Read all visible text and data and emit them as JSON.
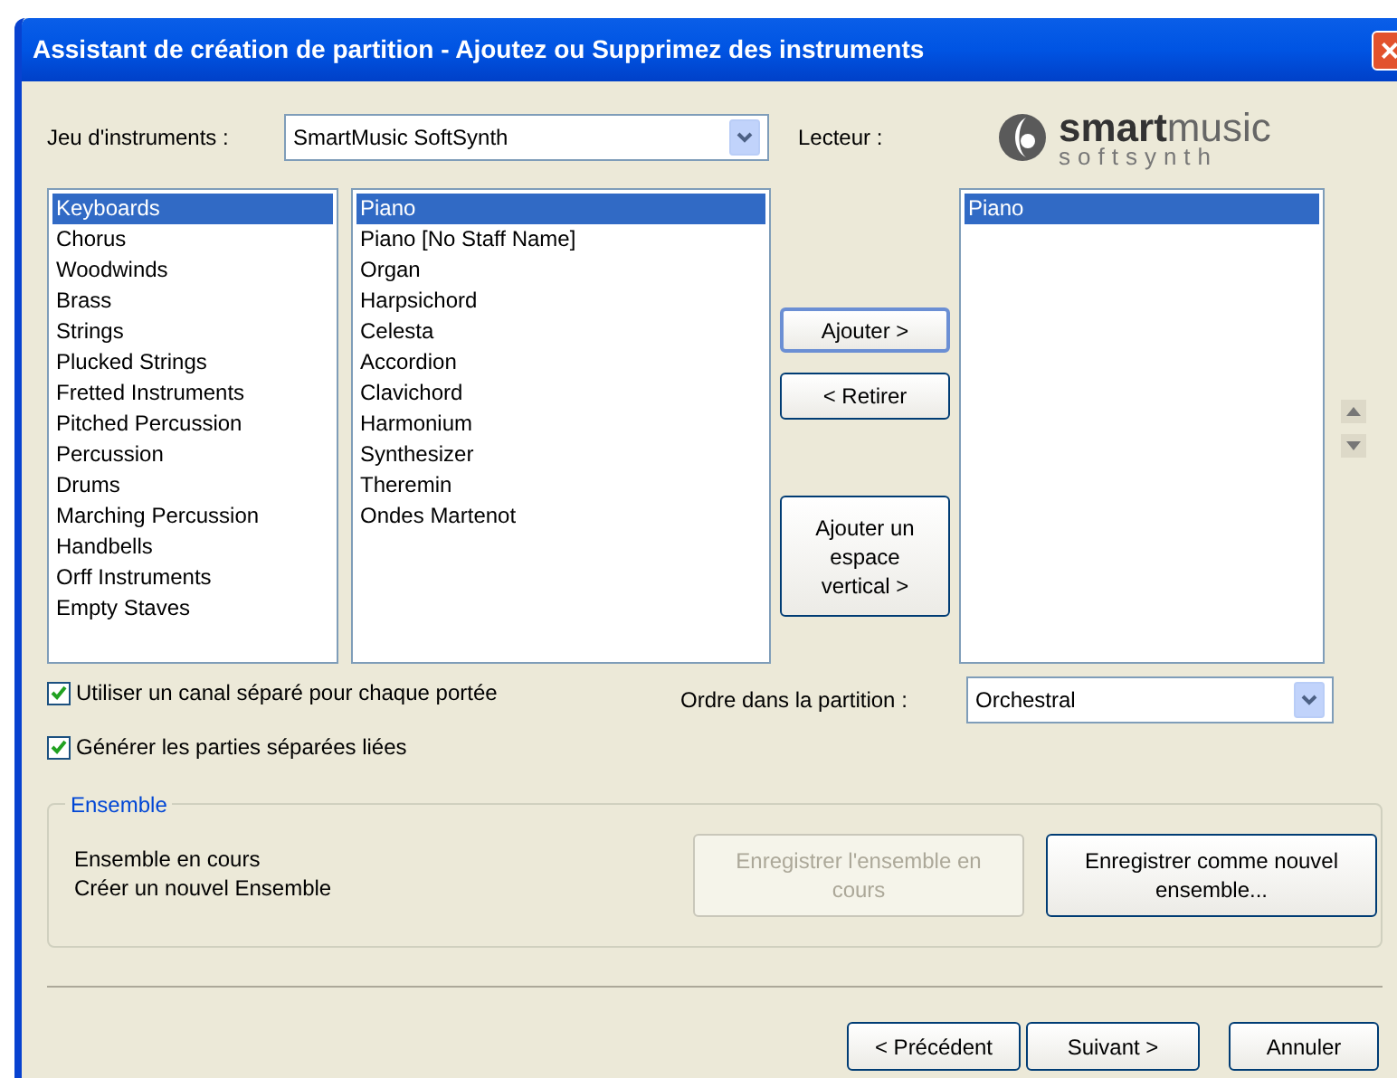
{
  "window": {
    "title": "Assistant de création de partition - Ajoutez ou Supprimez des instruments",
    "close": "×"
  },
  "instrument_set": {
    "label": "Jeu d'instruments :",
    "value": "SmartMusic SoftSynth"
  },
  "player": {
    "label": "Lecteur :",
    "logo_main": "smart",
    "logo_accent": "music",
    "logo_sub": "softsynth"
  },
  "categories": [
    {
      "label": "Keyboards",
      "selected": true
    },
    {
      "label": "Chorus",
      "selected": false
    },
    {
      "label": "Woodwinds",
      "selected": false
    },
    {
      "label": "Brass",
      "selected": false
    },
    {
      "label": "Strings",
      "selected": false
    },
    {
      "label": "Plucked Strings",
      "selected": false
    },
    {
      "label": "Fretted Instruments",
      "selected": false
    },
    {
      "label": "Pitched Percussion",
      "selected": false
    },
    {
      "label": "Percussion",
      "selected": false
    },
    {
      "label": "Drums",
      "selected": false
    },
    {
      "label": "Marching Percussion",
      "selected": false
    },
    {
      "label": "Handbells",
      "selected": false
    },
    {
      "label": "Orff Instruments",
      "selected": false
    },
    {
      "label": "Empty Staves",
      "selected": false
    }
  ],
  "instruments": [
    {
      "label": "Piano",
      "selected": true
    },
    {
      "label": "Piano [No Staff Name]",
      "selected": false
    },
    {
      "label": "Organ",
      "selected": false
    },
    {
      "label": "Harpsichord",
      "selected": false
    },
    {
      "label": "Celesta",
      "selected": false
    },
    {
      "label": "Accordion",
      "selected": false
    },
    {
      "label": "Clavichord",
      "selected": false
    },
    {
      "label": "Harmonium",
      "selected": false
    },
    {
      "label": "Synthesizer",
      "selected": false
    },
    {
      "label": "Theremin",
      "selected": false
    },
    {
      "label": "Ondes Martenot",
      "selected": false
    }
  ],
  "add_button": "Ajouter >",
  "remove_button": "< Retirer",
  "add_space_button": "Ajouter un espace vertical >",
  "score_instruments": [
    {
      "label": "Piano",
      "selected": true
    }
  ],
  "checkboxes": [
    {
      "label": "Utiliser un canal séparé pour chaque portée",
      "checked": true
    },
    {
      "label": "Générer les parties séparées liées",
      "checked": true
    }
  ],
  "score_order": {
    "label": "Ordre dans la partition :",
    "value": "Orchestral"
  },
  "ensemble": {
    "legend": "Ensemble",
    "lines": [
      "Ensemble en cours",
      "Créer un nouvel Ensemble"
    ],
    "buttons": [
      {
        "label": "Enregistrer l'ensemble en cours",
        "disabled": true
      },
      {
        "label": "Enregistrer comme nouvel ensemble...",
        "disabled": false
      }
    ]
  },
  "footer_buttons": [
    "< Précédent",
    "Suivant >",
    "Annuler"
  ]
}
